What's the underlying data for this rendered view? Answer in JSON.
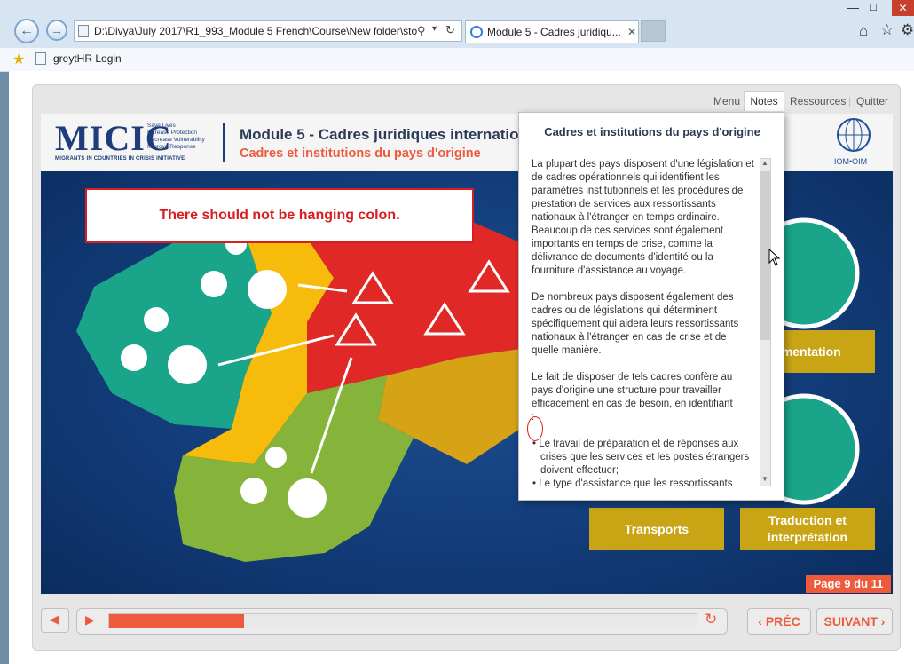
{
  "browser": {
    "address": "D:\\Divya\\July 2017\\R1_993_Module 5 French\\Course\\New folder\\sto",
    "tab_title": "Module 5 - Cadres juridiqu...",
    "favorite": "greytHR Login"
  },
  "player": {
    "nav": {
      "menu": "Menu",
      "notes": "Notes",
      "resources": "Ressources",
      "quit": "Quitter"
    },
    "header": {
      "logo_text": "MICIC",
      "logo_sub": "MIGRANTS IN COUNTRIES IN CRISIS INITIATIVE",
      "logo_tagline": [
        "Save Lives",
        "Increase Protection",
        "Decrease Vulnerability",
        "Improve Response"
      ],
      "module_title": "Module 5 - Cadres juridiques internation",
      "subtitle": "Cadres et institutions du pays d'origine",
      "iom_label": "IOM•OIM"
    },
    "callout": "There should not be hanging colon.",
    "tiles": {
      "documentation": "umentation",
      "transports": "Transports",
      "translation": "Traduction et interprétation"
    },
    "page_indicator": "Page 9 du 11",
    "controls": {
      "prev": "PRÉC",
      "next": "SUIVANT"
    },
    "progress": 0.23
  },
  "notes": {
    "title": "Cadres et institutions du pays d'origine",
    "para1": "La plupart des pays disposent d'une législation et de cadres opérationnels qui identifient les paramètres institutionnels et les procédures de prestation de services aux ressortissants nationaux à l'étranger en temps ordinaire. Beaucoup de ces services sont également importants en temps de crise, comme la délivrance de documents d'identité ou la fourniture d'assistance au voyage.",
    "para2": "De nombreux pays disposent également des cadres ou de législations qui déterminent spécifiquement qui aidera leurs ressortissants nationaux à l'étranger en cas de crise et de quelle manière.",
    "para3": "Le fait de disposer de tels cadres confère au pays d'origine une structure pour travailler efficacement en cas de besoin, en identifiant",
    "colon": ":",
    "bullets": [
      "Le travail de préparation et de réponses aux crises que les services et les postes étrangers doivent effectuer;",
      "Le type d'assistance que les ressortissants"
    ]
  },
  "colors": {
    "accent": "#ee5a3c",
    "tile": "#c9a516",
    "callout": "#d81e1e"
  }
}
